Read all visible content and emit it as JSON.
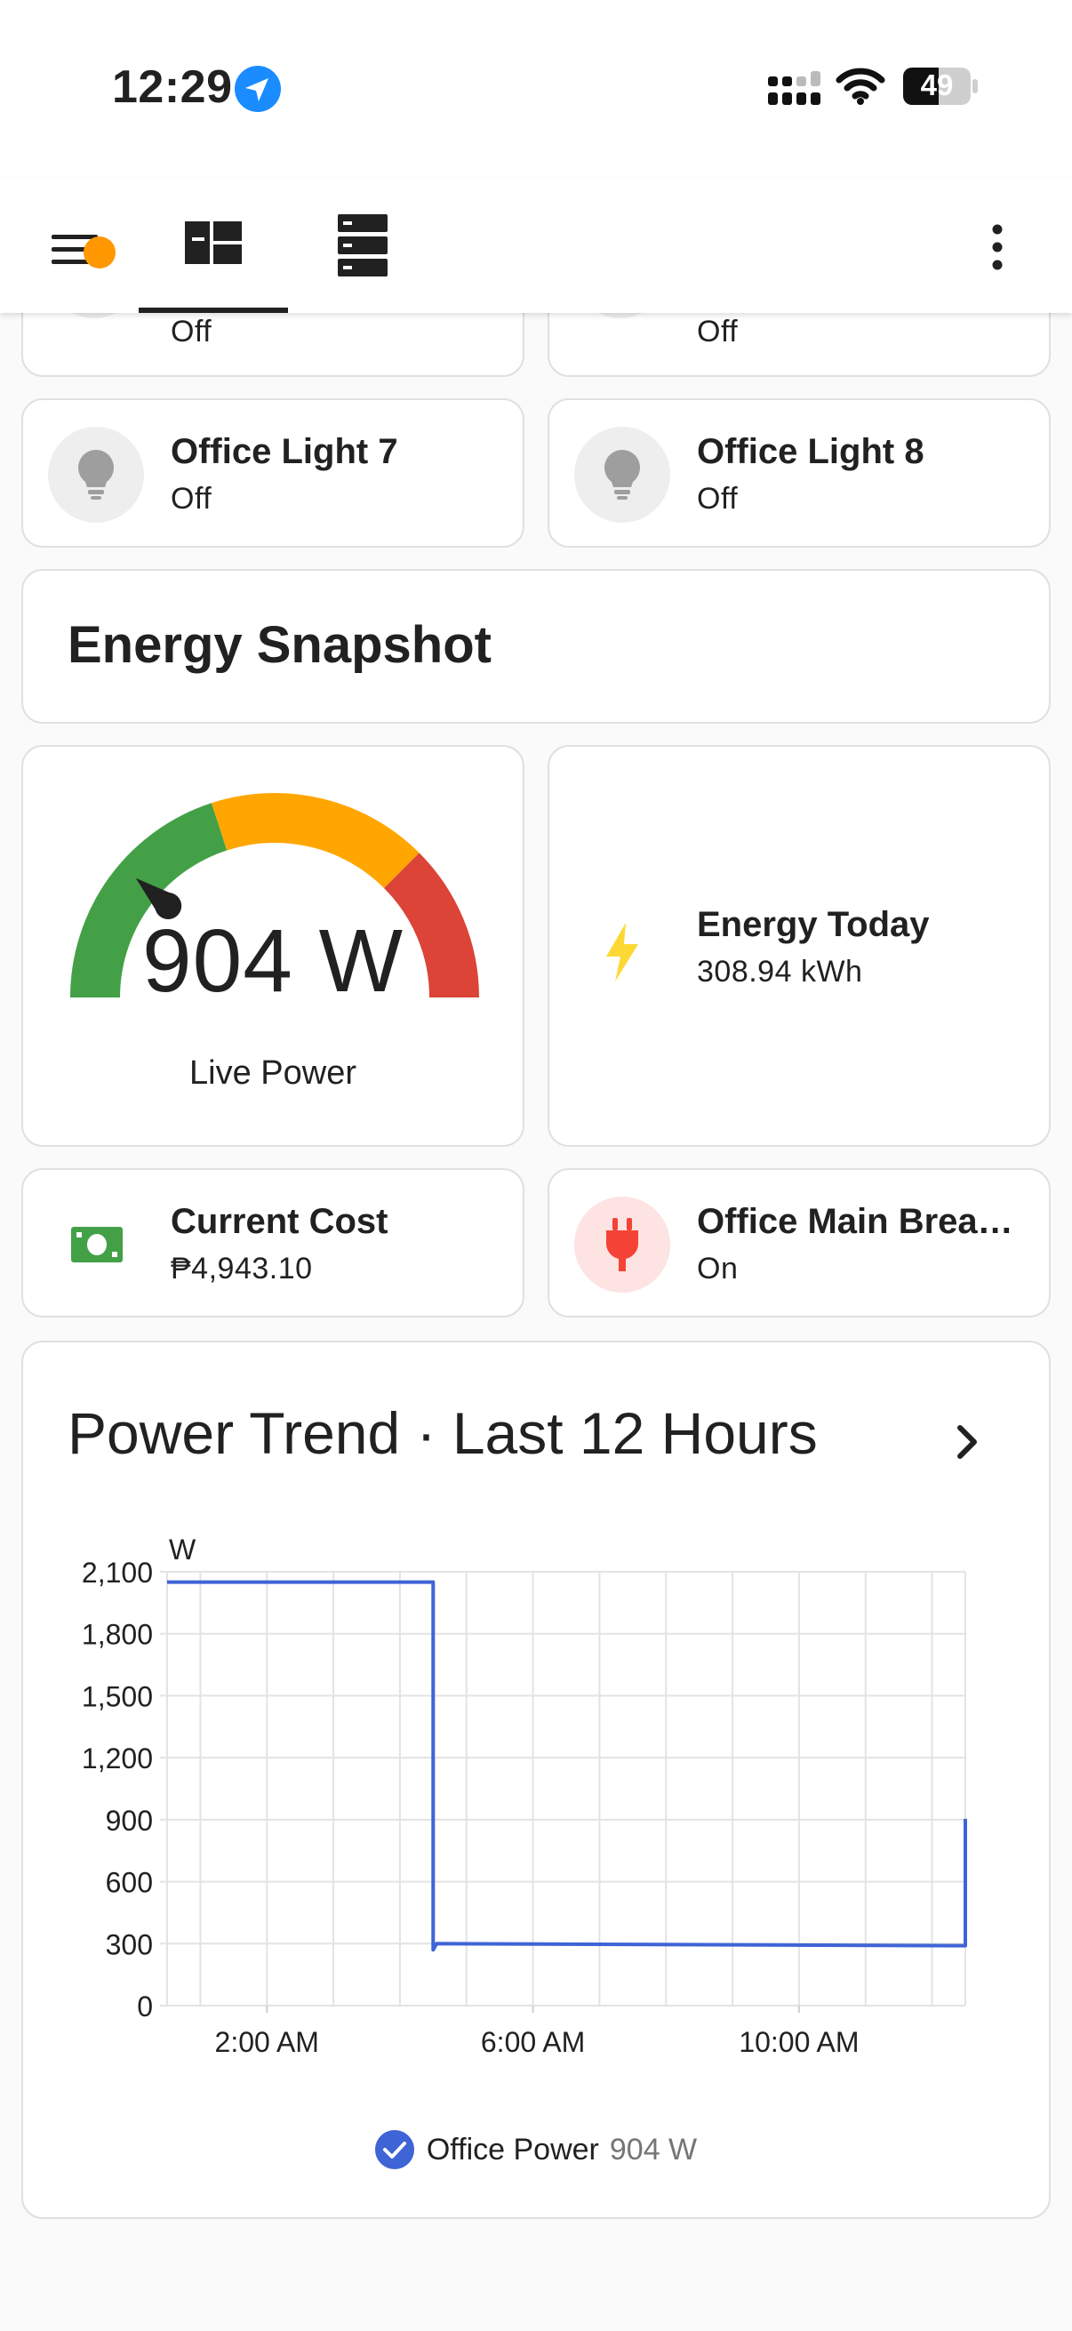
{
  "status_bar": {
    "time": "12:29",
    "battery": "49"
  },
  "app_bar": {
    "tabs": [
      "dashboard-icon",
      "entities-icon"
    ],
    "accent": "#ff9800"
  },
  "tiles_top": [
    {
      "name": "",
      "state": "Off"
    },
    {
      "name": "",
      "state": "Off"
    }
  ],
  "tiles": [
    {
      "name": "Office Light 7",
      "state": "Off",
      "icon": "lightbulb-icon"
    },
    {
      "name": "Office Light 8",
      "state": "Off",
      "icon": "lightbulb-icon"
    }
  ],
  "energy_section": {
    "title": "Energy Snapshot"
  },
  "gauge": {
    "value": "904 W",
    "label": "Live Power",
    "level": 904,
    "min": 0,
    "max": 4000,
    "colors": [
      "#43a047",
      "#ffa600",
      "#db4437"
    ]
  },
  "energy_today": {
    "name": "Energy Today",
    "state": "308.94 kWh",
    "icon": "lightning-icon",
    "color": "#fdd835"
  },
  "current_cost": {
    "name": "Current Cost",
    "state": "₱4,943.10",
    "icon": "cash-icon",
    "color": "#43a047"
  },
  "breaker": {
    "name": "Office Main Brea…",
    "state": "On",
    "icon": "power-plug-icon",
    "color": "#f44336"
  },
  "power_trend": {
    "title": "Power Trend · Last 12 Hours",
    "legend_name": "Office Power",
    "legend_value": "904 W"
  },
  "chart_data": {
    "type": "line",
    "ylabel": "W",
    "xlabel": "",
    "ylim": [
      0,
      2100
    ],
    "yticks": [
      "0",
      "300",
      "600",
      "900",
      "1,200",
      "1,500",
      "1,800",
      "2,100"
    ],
    "ytick_values": [
      0,
      300,
      600,
      900,
      1200,
      1500,
      1800,
      2100
    ],
    "xticks": [
      "2:00 AM",
      "6:00 AM",
      "10:00 AM"
    ],
    "xtick_hours": [
      2,
      6,
      10
    ],
    "xlim_hours": [
      0.5,
      12.5
    ],
    "grid": true,
    "series": [
      {
        "name": "Office Power",
        "color": "#3f64d6",
        "points": [
          {
            "x": 0.5,
            "y": 2050
          },
          {
            "x": 4.5,
            "y": 2050
          },
          {
            "x": 4.5,
            "y": 270
          },
          {
            "x": 4.55,
            "y": 300
          },
          {
            "x": 12.5,
            "y": 290
          },
          {
            "x": 12.5,
            "y": 904
          }
        ]
      }
    ]
  }
}
